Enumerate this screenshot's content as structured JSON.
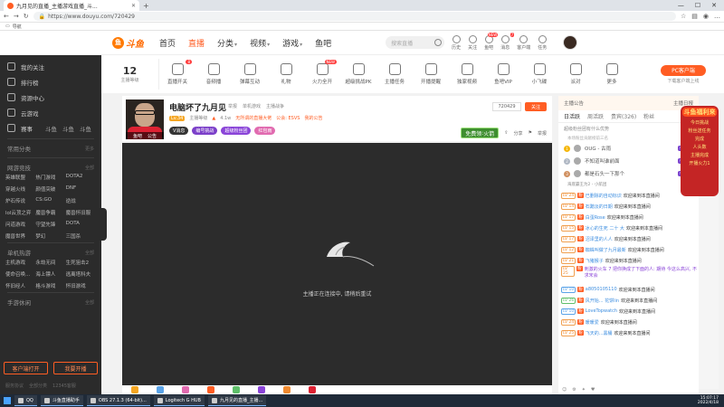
{
  "browser": {
    "tab_title": "九月见的直播_主播游戏直播_斗...",
    "url": "https://www.douyu.com/720429",
    "bookmark": "导航"
  },
  "header": {
    "logo_text": "斗鱼",
    "nav": [
      "首页",
      "直播",
      "分类",
      "视频",
      "游戏",
      "鱼吧"
    ],
    "search_placeholder": "搜索直播",
    "icons": [
      {
        "label": "历史",
        "icon": "history-icon",
        "badge": ""
      },
      {
        "label": "关注",
        "icon": "follow-icon",
        "badge": ""
      },
      {
        "label": "鱼吧",
        "icon": "fishbar-icon",
        "badge": "NEW"
      },
      {
        "label": "消息",
        "icon": "message-icon",
        "badge": "7"
      },
      {
        "label": "客户端",
        "icon": "client-icon",
        "badge": ""
      },
      {
        "label": "任务",
        "icon": "task-icon",
        "badge": ""
      }
    ]
  },
  "sidebar": {
    "items": [
      {
        "label": "我的关注",
        "icon": "heart-icon"
      },
      {
        "label": "排行榜",
        "icon": "rank-icon"
      },
      {
        "label": "资源中心",
        "icon": "resource-icon"
      },
      {
        "label": "云游戏",
        "icon": "cloud-game-icon"
      },
      {
        "label": "赛事",
        "icon": "trophy-icon"
      }
    ],
    "event_row": [
      "斗鱼",
      "斗鱼",
      "斗鱼"
    ],
    "sections": [
      {
        "title": "常用分类",
        "more": "更多",
        "grid": []
      },
      {
        "title": "网游竞技",
        "more": "全部",
        "grid": [
          "英雄联盟",
          "热门游戏",
          "DOTA2",
          "穿越火线",
          "颜值突破",
          "DNF",
          "炉石传说",
          "CS:GO",
          "逆战",
          "lol云顶之弈",
          "魔兽争霸",
          "魔兽怀旧服",
          "问道游戏",
          "守望先锋",
          "DOTA",
          "魔兽世界",
          "梦幻",
          "三国杀"
        ]
      },
      {
        "title": "单机热游",
        "more": "全部",
        "grid": [
          "主机游戏",
          "永劫无间",
          "生死狙击2",
          "使命召唤...",
          "海上镖人",
          "逃离塔科夫",
          "怀旧经人",
          "格斗游戏",
          "怀旧游戏"
        ]
      },
      {
        "title": "手游休闲",
        "more": "全部",
        "grid": []
      }
    ],
    "btn_client": "客户端打开",
    "btn_live": "我要开播",
    "footer": [
      "服务协议",
      "全部分类",
      "12345客服"
    ]
  },
  "categories": {
    "first_num": "12",
    "first_label": "主播等级",
    "items": [
      {
        "label": "直播开关",
        "icon": "live-switch-icon",
        "tag": "8"
      },
      {
        "label": "音频播",
        "icon": "audio-icon",
        "tag": ""
      },
      {
        "label": "弹幕互动",
        "icon": "danmu-icon",
        "tag": ""
      },
      {
        "label": "礼物",
        "icon": "gift-icon",
        "tag": ""
      },
      {
        "label": "火力全开",
        "icon": "fire-icon",
        "tag": "NEW"
      },
      {
        "label": "超级挑战PK",
        "icon": "pk-icon",
        "tag": ""
      },
      {
        "label": "主播任务",
        "icon": "mission-icon",
        "tag": ""
      },
      {
        "label": "开播提醒",
        "icon": "alarm-icon",
        "tag": ""
      },
      {
        "label": "独家视频",
        "icon": "video-icon",
        "tag": ""
      },
      {
        "label": "鱼吧VIP",
        "icon": "vip-icon",
        "tag": ""
      },
      {
        "label": "小飞碟",
        "icon": "ufo-icon",
        "tag": ""
      },
      {
        "label": "派对",
        "icon": "party-icon",
        "tag": ""
      },
      {
        "label": "更多",
        "icon": "more-icon",
        "tag": ""
      }
    ],
    "pc_btn": "PC客户端",
    "pc_sub": "下载客户端上线"
  },
  "stream": {
    "title": "电脑坏了九月见",
    "meta": [
      "举报",
      "单机游戏",
      "主播战争"
    ],
    "pic_labels": [
      "鱼吧",
      "公告"
    ],
    "level": "Lv.34",
    "host_label": "主播等级",
    "heat": "4.1w",
    "tag1": "无所谓的直播大佬",
    "tag2": "公会: ESVS",
    "tag3": "我的公告",
    "pills": [
      "V消息",
      "编号挑战",
      "超级粉丝团",
      "红包雨"
    ],
    "follow_count": "720429",
    "follow_label": "关注",
    "free_gift": "免费领",
    "free_gift_num": "火箭",
    "share": "分享",
    "report": "举报"
  },
  "player": {
    "message": "主播正在连接中, 请稍后重试"
  },
  "rpanel": {
    "top_left": "主播公告",
    "top_right": "主播日报",
    "tabs": [
      "日活跃",
      "周活跃",
      "贵宾(326)",
      "粉丝"
    ],
    "sub_left": "超级粉丝团有什么优势",
    "sub_right": "充值",
    "rank_head": "本场粉丝贡献榜前三名",
    "rank": [
      {
        "no": "1",
        "name": "OUG - 古雨",
        "tag": "小航团"
      },
      {
        "no": "2",
        "name": "不知道叫谁前面",
        "tag": "小航团"
      },
      {
        "no": "3",
        "name": "都是石头一下那个",
        "tag": "小航团"
      }
    ],
    "rank_extra": "海底霸王为2 - 小航团",
    "chat": [
      {
        "lv": "LV 24",
        "badge": "粉",
        "nick": "已删除的自动标识",
        "text": "欢迎来到本直播间"
      },
      {
        "lv": "LV 14",
        "badge": "粉",
        "nick": "石黯淡的日期",
        "text": "欢迎来到本直播间"
      },
      {
        "lv": "LV 17",
        "badge": "粉",
        "nick": "白蛋Rose",
        "text": "欢迎来到本直播间"
      },
      {
        "lv": "LV 15",
        "badge": "粉",
        "nick": "冰心的生死 二十 大",
        "text": "欢迎来到本直播间"
      },
      {
        "lv": "LV 17",
        "badge": "粉",
        "nick": "沼泽里的人人",
        "text": "欢迎来到本直播间"
      },
      {
        "lv": "LV 12",
        "badge": "粉",
        "nick": "蜘蛛叫做了九月最新",
        "text": "欢迎来到本直播间"
      },
      {
        "lv": "LV 21",
        "badge": "粉",
        "nick": "飞猪猴子",
        "text": "欢迎来到本直播间"
      },
      {
        "lv": "LV 25",
        "badge": "粉",
        "nick": "刺激的火车 7",
        "text": "把你换成了下面的人: 期待 今这么高兴, 不求宋会"
      },
      {
        "lv": "LV 10",
        "badge": "粉",
        "nick": "a8050105110",
        "text": "欢迎来到本直播间"
      },
      {
        "lv": "LV 26",
        "badge": "粉",
        "nick": "风开始... 花饼lin",
        "text": "欢迎来到本直播间"
      },
      {
        "lv": "LV 10",
        "badge": "粉",
        "nick": "LoveTopwatch",
        "text": "欢迎来到本直播间"
      },
      {
        "lv": "LV 24",
        "badge": "粉",
        "nick": "暖暖爱",
        "text": "欢迎来到本直播间"
      },
      {
        "lv": "LV 25",
        "badge": "粉",
        "nick": "飞天的...黑桶",
        "text": "欢迎来到本直播间"
      }
    ]
  },
  "promo": {
    "title": "斗鱼福利来",
    "lines": [
      "今日挑战",
      "粉丝送任务",
      "完成",
      "人头数",
      "主播完成",
      "开播火力1"
    ]
  },
  "taskbar": {
    "items": [
      "QQ",
      "斗鱼直播助手",
      "OBS 27.1.3 (64-bit)...",
      "Logitech G HUB",
      "九月见的直播_主播..."
    ],
    "time": "15:07:17",
    "date": "2022/4/18"
  },
  "colors": {
    "brand": "#ff5d23",
    "sidebar_bg": "#2b2b2b",
    "player_bg": "#2c2c2c"
  }
}
